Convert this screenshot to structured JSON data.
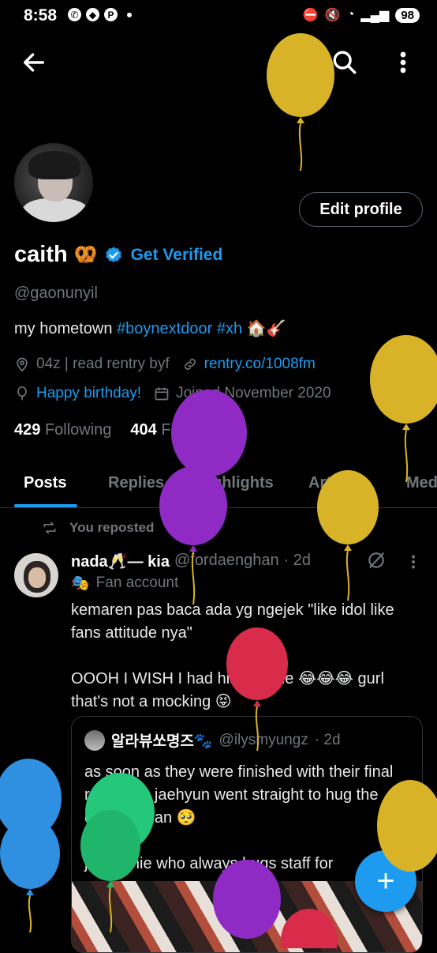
{
  "status_bar": {
    "time": "8:58",
    "battery": "98"
  },
  "profile": {
    "name": "caith",
    "name_emoji": "🥨",
    "get_verified": "Get Verified",
    "handle": "@gaonunyil",
    "bio_prefix": "my hometown ",
    "bio_tag1": "#boynextdoor",
    "bio_tag2": "#xh",
    "bio_emoji": "🏠🎸",
    "location": "04z | read rentry byf",
    "website": "rentry.co/1008fm",
    "birthday": "Happy birthday!",
    "joined": "Joined November 2020",
    "following_count": "429",
    "following_label": "Following",
    "followers_count": "404",
    "followers_label": "Followers",
    "edit_button": "Edit profile"
  },
  "tabs": [
    "Posts",
    "Replies",
    "Highlights",
    "Articles",
    "Media"
  ],
  "post": {
    "repost_label": "You reposted",
    "author_name": "nada🥂— kia",
    "author_handle": "@fordaenghan",
    "time": "· 2d",
    "badge": "Fan account",
    "text": "kemaren pas baca ada yg ngejek \"like idol like fans attitude nya\"\n\n OOOH I WISH I had his attitude 😂😂😂 gurl that's not a mocking 😝",
    "quote": {
      "author_name": "알라뷰쏘명즈🐾",
      "author_handle": "@ilysmyungz",
      "time": "· 2d",
      "text": "as soon as they were finished with their final recording jaehyun went straight to hug the camera man 🥺\n\njaehyunie who always hugs staff for"
    }
  },
  "balloon_colors": {
    "yellow": "#d9b327",
    "purple": "#8f2bc4",
    "red": "#d92b4a",
    "green": "#25c77a",
    "blue": "#2f8fe0"
  }
}
